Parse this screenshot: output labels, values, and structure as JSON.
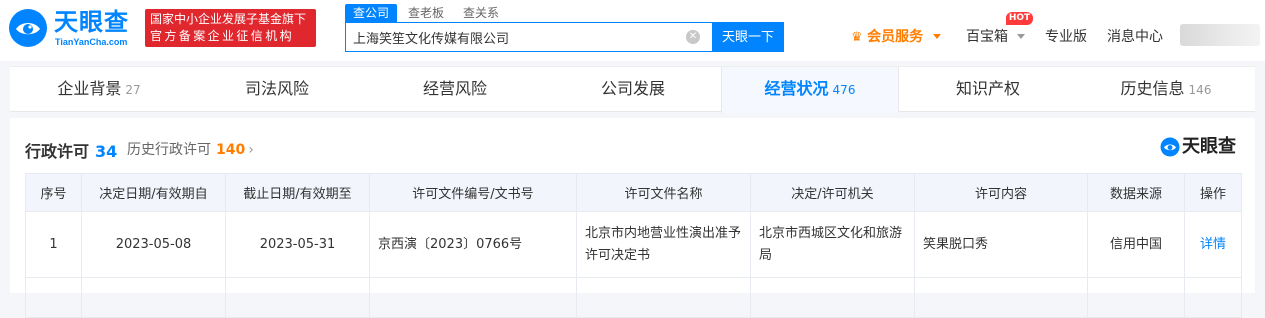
{
  "header": {
    "logo_cn": "天眼查",
    "logo_en": "TianYanCha.com",
    "badge_line1": "国家中小企业发展子基金旗下",
    "badge_line2": "官方备案企业征信机构",
    "search_tabs": [
      "查公司",
      "查老板",
      "查关系"
    ],
    "search_value": "上海笑笙文化传媒有限公司",
    "search_button": "天眼一下",
    "nav": {
      "vip": "会员服务",
      "baobao": "百宝箱",
      "hot": "HOT",
      "pro": "专业版",
      "messages": "消息中心"
    }
  },
  "tabs": [
    {
      "label": "企业背景",
      "count": "27"
    },
    {
      "label": "司法风险",
      "count": ""
    },
    {
      "label": "经营风险",
      "count": ""
    },
    {
      "label": "公司发展",
      "count": ""
    },
    {
      "label": "经营状况",
      "count": "476"
    },
    {
      "label": "知识产权",
      "count": ""
    },
    {
      "label": "历史信息",
      "count": "146"
    }
  ],
  "section": {
    "title": "行政许可",
    "count": "34",
    "history_label": "历史行政许可",
    "history_count": "140",
    "watermark": "天眼查"
  },
  "table": {
    "headers": [
      "序号",
      "决定日期/有效期自",
      "截止日期/有效期至",
      "许可文件编号/文书号",
      "许可文件名称",
      "决定/许可机关",
      "许可内容",
      "数据来源",
      "操作"
    ],
    "rows": [
      [
        "1",
        "2023-05-08",
        "2023-05-31",
        "京西演〔2023〕0766号",
        "北京市内地营业性演出准予许可决定书",
        "北京市西城区文化和旅游局",
        "笑果脱口秀",
        "信用中国",
        "详情"
      ]
    ]
  },
  "colors": {
    "brand": "#0084ff",
    "badge": "#e0272e",
    "accent": "#ff7d00"
  }
}
